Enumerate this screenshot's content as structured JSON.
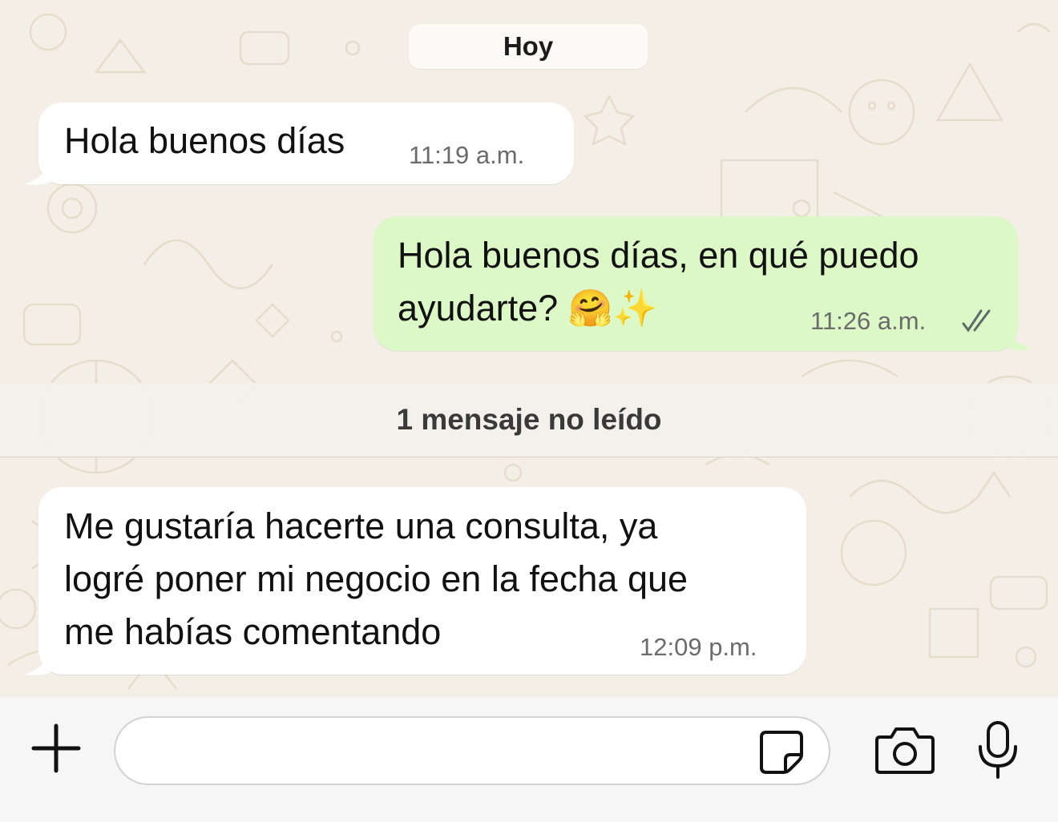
{
  "chat": {
    "date_label": "Hoy",
    "unread_label": "1 mensaje no leído",
    "messages": [
      {
        "direction": "incoming",
        "lines": [
          "Hola buenos días"
        ],
        "time": "11:19 a.m."
      },
      {
        "direction": "outgoing",
        "lines": [
          "Hola buenos días, en qué puedo",
          "ayudarte? 🤗✨"
        ],
        "time": "11:26 a.m.",
        "status_icon": "double-check-icon"
      },
      {
        "direction": "incoming",
        "lines": [
          "Me gustaría hacerte una consulta, ya",
          "logré poner mi negocio en la fecha que",
          "me habías comentando"
        ],
        "time": "12:09 p.m."
      }
    ]
  },
  "composer": {
    "value": "",
    "placeholder": "",
    "icons": [
      "plus-icon",
      "sticker-icon",
      "camera-icon",
      "microphone-icon"
    ]
  },
  "colors": {
    "background": "#f4efe6",
    "incoming_bubble": "#ffffff",
    "outgoing_bubble": "#dcf8c6",
    "timestamp": "#6b6b6b"
  }
}
